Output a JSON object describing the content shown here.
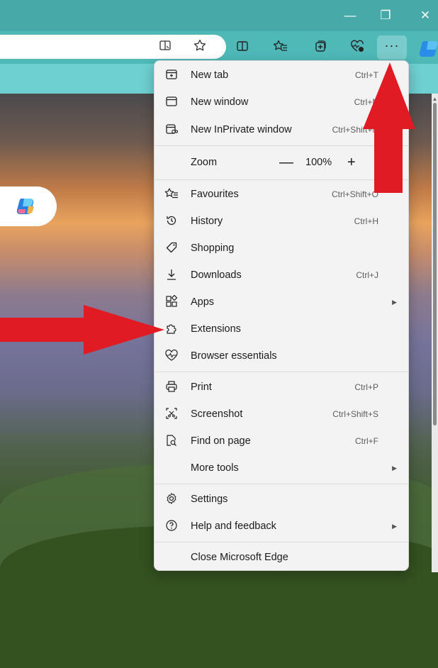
{
  "window": {
    "controls": {
      "minimize": "—",
      "restore": "❐",
      "close": "✕"
    }
  },
  "toolbar": {
    "icons": [
      "reader-mode-icon",
      "favorite-star-icon",
      "split-screen-icon",
      "favourites-icon",
      "collections-icon",
      "browser-essentials-icon"
    ],
    "more_label": "···"
  },
  "menu": {
    "items": [
      {
        "id": "new-tab",
        "icon": "new-tab-icon",
        "label": "New tab",
        "shortcut": "Ctrl+T"
      },
      {
        "id": "new-window",
        "icon": "new-window-icon",
        "label": "New window",
        "shortcut": "Ctrl+N"
      },
      {
        "id": "new-inprivate",
        "icon": "inprivate-icon",
        "label": "New InPrivate window",
        "shortcut": "Ctrl+Shift+N"
      },
      {
        "id": "favourites",
        "icon": "favourites-icon",
        "label": "Favourites",
        "shortcut": "Ctrl+Shift+O"
      },
      {
        "id": "history",
        "icon": "history-icon",
        "label": "History",
        "shortcut": "Ctrl+H"
      },
      {
        "id": "shopping",
        "icon": "shopping-tag-icon",
        "label": "Shopping",
        "shortcut": ""
      },
      {
        "id": "downloads",
        "icon": "download-icon",
        "label": "Downloads",
        "shortcut": "Ctrl+J"
      },
      {
        "id": "apps",
        "icon": "apps-icon",
        "label": "Apps",
        "shortcut": ""
      },
      {
        "id": "extensions",
        "icon": "puzzle-icon",
        "label": "Extensions",
        "shortcut": ""
      },
      {
        "id": "browser-essentials",
        "icon": "heart-pulse-icon",
        "label": "Browser essentials",
        "shortcut": ""
      },
      {
        "id": "print",
        "icon": "printer-icon",
        "label": "Print",
        "shortcut": "Ctrl+P"
      },
      {
        "id": "screenshot",
        "icon": "screenshot-icon",
        "label": "Screenshot",
        "shortcut": "Ctrl+Shift+S"
      },
      {
        "id": "find",
        "icon": "find-icon",
        "label": "Find on page",
        "shortcut": "Ctrl+F"
      },
      {
        "id": "more-tools",
        "icon": "",
        "label": "More tools",
        "shortcut": ""
      },
      {
        "id": "settings",
        "icon": "gear-icon",
        "label": "Settings",
        "shortcut": ""
      },
      {
        "id": "help",
        "icon": "help-icon",
        "label": "Help and feedback",
        "shortcut": ""
      },
      {
        "id": "close-edge",
        "icon": "",
        "label": "Close Microsoft Edge",
        "shortcut": ""
      }
    ],
    "zoom": {
      "label": "Zoom",
      "minus": "—",
      "value": "100%",
      "plus": "+"
    }
  },
  "colors": {
    "titlebar": "#47a9a8",
    "toolbar": "#4fb9b8",
    "annotation_red": "#e01b24"
  }
}
